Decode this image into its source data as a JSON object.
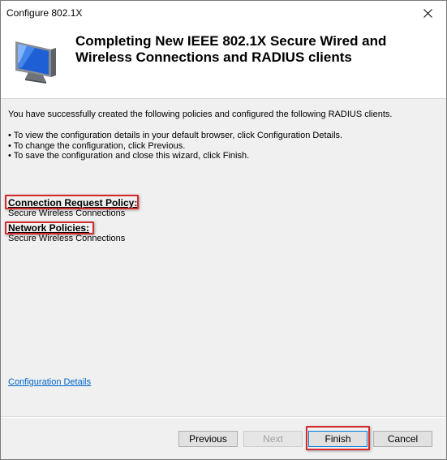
{
  "window": {
    "title": "Configure 802.1X"
  },
  "header": {
    "title": "Completing New IEEE 802.1X Secure Wired and Wireless Connections and RADIUS clients"
  },
  "content": {
    "intro": "You have successfully created the following policies and configured the following RADIUS clients.",
    "bullets": [
      "• To view the configuration details in your default browser, click Configuration Details.",
      "• To change the configuration, click Previous.",
      "• To save the configuration and close this wizard, click Finish."
    ],
    "connection_request_policy": {
      "label": "Connection Request Policy:",
      "value": "Secure Wireless Connections"
    },
    "network_policies": {
      "label": "Network Policies:",
      "value": "Secure Wireless Connections"
    },
    "configuration_details_link": "Configuration Details"
  },
  "buttons": {
    "previous": "Previous",
    "next": "Next",
    "finish": "Finish",
    "cancel": "Cancel"
  },
  "colors": {
    "highlight_box": "#d42a2a",
    "link": "#0066cc",
    "window_background": "#f0f0f0"
  },
  "icons": {
    "header": "computer-monitor-icon",
    "close": "close-icon"
  }
}
